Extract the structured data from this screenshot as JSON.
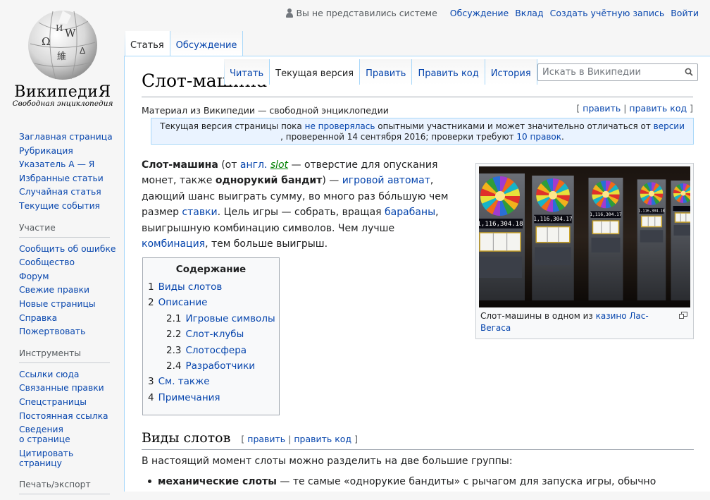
{
  "personal": {
    "anon": "Вы не представились системе",
    "links": [
      "Обсуждение",
      "Вклад",
      "Создать учётную запись",
      "Войти"
    ]
  },
  "logo": {
    "wordmark": "ВикипедиЯ",
    "tagline": "Свободная энциклопедия",
    "glyphs": [
      "Ω",
      "W",
      "И",
      "維",
      "ᐃ"
    ]
  },
  "sidebar": {
    "nav": [
      "Заглавная страница",
      "Рубрикация",
      "Указатель А — Я",
      "Избранные статьи",
      "Случайная статья",
      "Текущие события"
    ],
    "participation": {
      "heading": "Участие",
      "items": [
        "Сообщить об ошибке",
        "Сообщество",
        "Форум",
        "Свежие правки",
        "Новые страницы",
        "Справка",
        "Пожертвовать"
      ]
    },
    "tools": {
      "heading": "Инструменты",
      "items": [
        "Ссылки сюда",
        "Связанные правки",
        "Спецстраницы",
        "Постоянная ссылка",
        "Сведения\nо странице",
        "Цитировать\nстраницу"
      ]
    },
    "export": {
      "heading": "Печать/экспорт"
    }
  },
  "tabs": {
    "left": [
      "Статья",
      "Обсуждение"
    ],
    "right": [
      "Читать",
      "Текущая версия",
      "Править",
      "Править код",
      "История"
    ]
  },
  "search": {
    "placeholder": "Искать в Википедии"
  },
  "article": {
    "title": "Слот-машина",
    "site_sub": "Материал из Википедии — свободной энциклопедии",
    "edit_links": {
      "open": "[",
      "edit": "править",
      "sep": "|",
      "edit_source": "править код",
      "close": "]"
    },
    "review": {
      "t1": "Текущая версия страницы пока ",
      "l1": "не проверялась",
      "t2": " опытными участниками и может значительно отличаться от ",
      "l2": "версии",
      "t3": ", проверенной 14 сентября 2016; проверки требуют ",
      "l3": "10 правок",
      "t4": "."
    },
    "lead": {
      "b1": "Слот-машина",
      "t1": " (от ",
      "l1": "англ.",
      "t2": " ",
      "l2": "slot",
      "t3": " — отверстие для опускания монет, также ",
      "b2": "однорукий бандит",
      "t4": ") — ",
      "l3": "игровой автомат",
      "t5": ", дающий шанс выиграть сумму, во много раз бо́льшую чем размер ",
      "l4": "ставки",
      "t6": ". Цель игры — собрать, вращая ",
      "l5": "барабаны",
      "t7": ", выигрышную комбинацию символов. Чем лучше ",
      "l6": "комбинация",
      "t8": ", тем больше выигрыш."
    },
    "thumb": {
      "cap1": "Слот-машины в одном из ",
      "l1": "казино",
      "cap2": " ",
      "l2": "Лас-Вегаса",
      "jackpots": [
        "1,116,304.18",
        "1,116,304.17",
        "1,116,304.17",
        "1,116,304.18"
      ]
    },
    "toc": {
      "title": "Содержание",
      "items": [
        {
          "num": "1",
          "label": "Виды слотов",
          "level": 1
        },
        {
          "num": "2",
          "label": "Описание",
          "level": 1
        },
        {
          "num": "2.1",
          "label": "Игровые символы",
          "level": 2
        },
        {
          "num": "2.2",
          "label": "Слот-клубы",
          "level": 2
        },
        {
          "num": "2.3",
          "label": "Слотосфера",
          "level": 2
        },
        {
          "num": "2.4",
          "label": "Разработчики",
          "level": 2
        },
        {
          "num": "3",
          "label": "См. также",
          "level": 1
        },
        {
          "num": "4",
          "label": "Примечания",
          "level": 1
        }
      ]
    },
    "section1": {
      "title": "Виды слотов",
      "open": "[",
      "edit": "править",
      "sep": "|",
      "edit_source": "править код",
      "close": "]",
      "para": "В настоящий момент слоты можно разделить на две большие группы:",
      "li1_bold": "механические слоты",
      "li1_text": " — те самые «однорукие бандиты» с рычагом для запуска игры, обычно"
    }
  },
  "colors": {
    "link": "#0645ad",
    "tab_border": "#a7d7f9",
    "review_bg": "#eaf3ff"
  }
}
